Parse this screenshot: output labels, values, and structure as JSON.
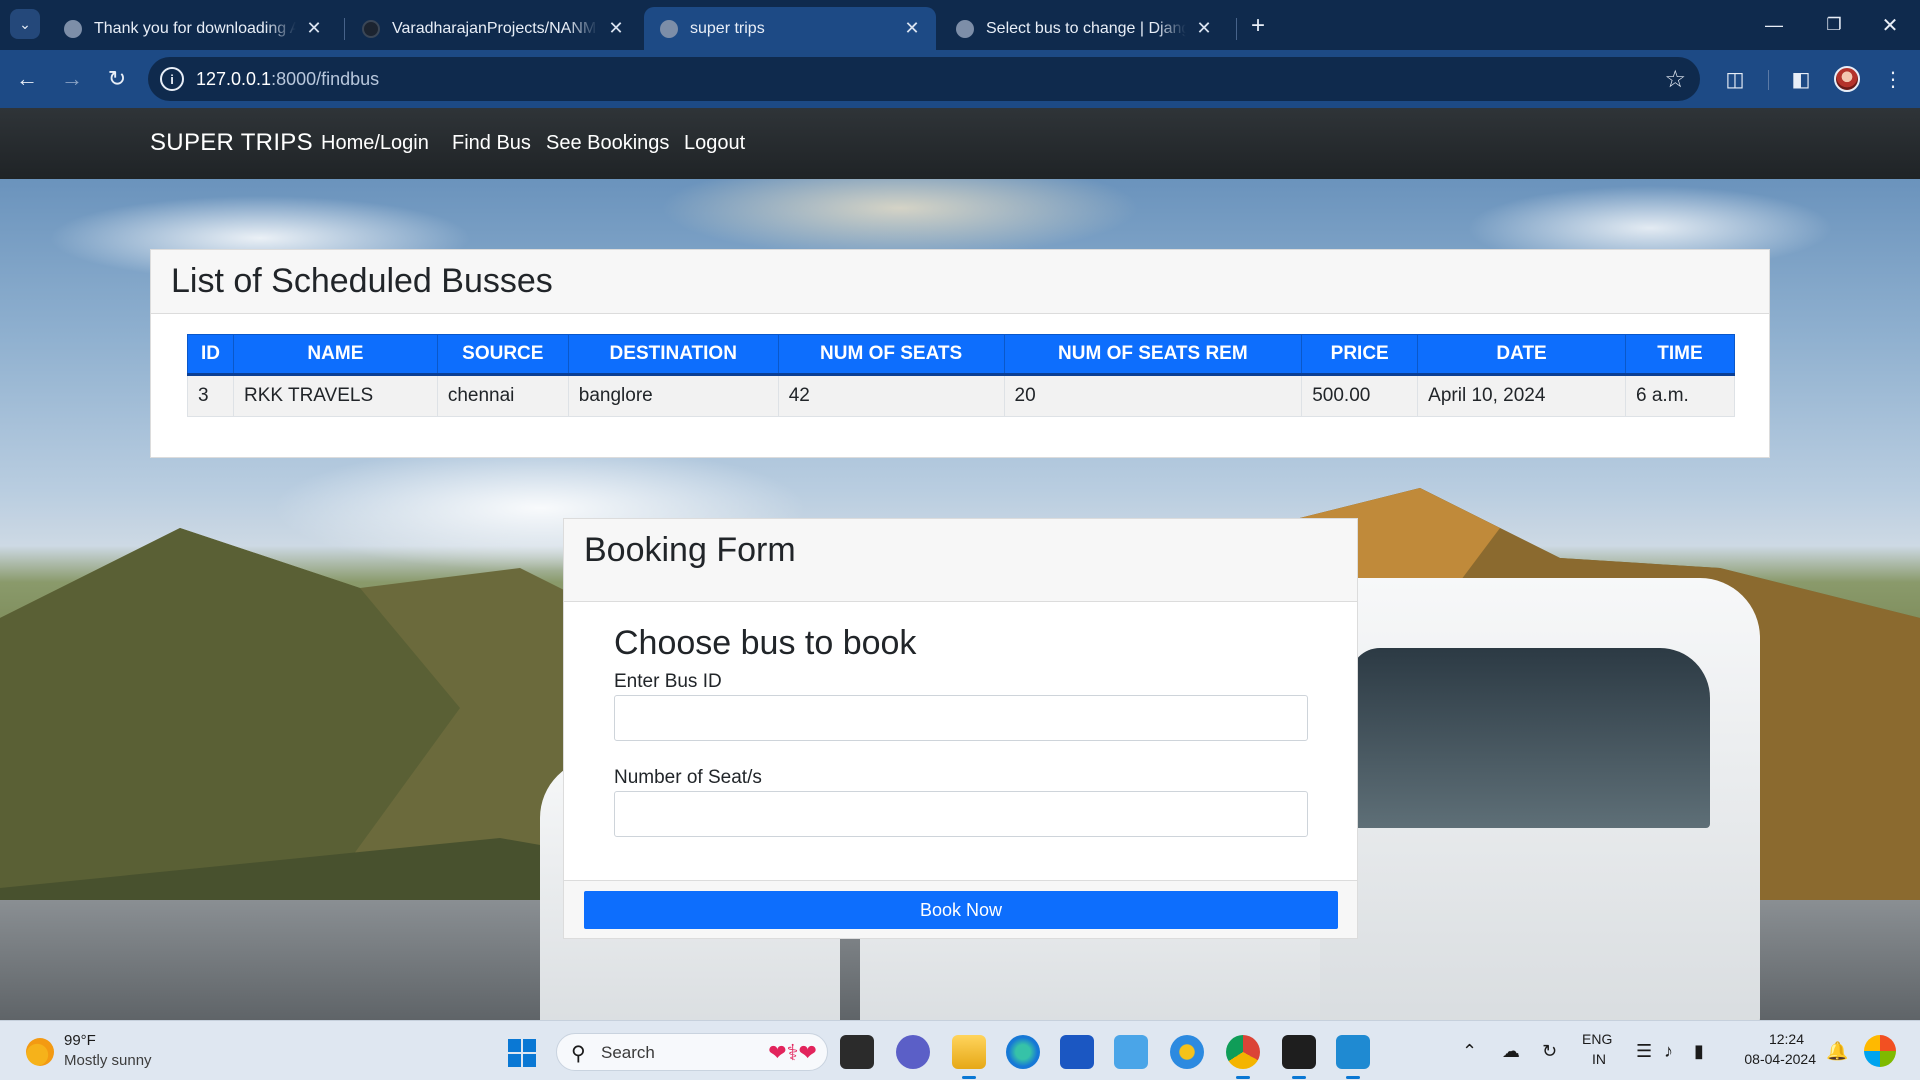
{
  "browser": {
    "tabs": [
      {
        "title": "Thank you for downloading AnyDesk",
        "active": false
      },
      {
        "title": "VaradharajanProjects/NANMUDHALVAN",
        "active": false
      },
      {
        "title": "super trips",
        "active": true
      },
      {
        "title": "Select bus to change | Django site admin",
        "active": false
      }
    ],
    "new_tab_symbol": "+",
    "url_host": "127.0.0.1",
    "url_rest": ":8000/findbus"
  },
  "site": {
    "brand": "SUPER TRIPS",
    "nav": [
      "Home/Login",
      "Find Bus",
      "See Bookings",
      "Logout"
    ]
  },
  "bus_list": {
    "title": "List of Scheduled Busses",
    "columns": [
      "ID",
      "NAME",
      "SOURCE",
      "DESTINATION",
      "NUM OF SEATS",
      "NUM OF SEATS REM",
      "PRICE",
      "DATE",
      "TIME"
    ],
    "rows": [
      [
        "3",
        "RKK TRAVELS",
        "chennai",
        "banglore",
        "42",
        "20",
        "500.00",
        "April 10, 2024",
        "6 a.m."
      ]
    ]
  },
  "booking_form": {
    "header": "Booking Form",
    "subtitle": "Choose bus to book",
    "bus_id_label": "Enter Bus ID",
    "bus_id_value": "",
    "seats_label": "Number of Seat/s",
    "seats_value": "",
    "submit_label": "Book Now"
  },
  "taskbar": {
    "weather_temp": "99°F",
    "weather_desc": "Mostly sunny",
    "search_label": "Search",
    "lang_top": "ENG",
    "lang_bottom": "IN",
    "time": "12:24",
    "date": "08-04-2024"
  },
  "colors": {
    "primary": "#0d6efd",
    "navbar": "#2b3035",
    "browser_frame": "#0f2a4d"
  }
}
